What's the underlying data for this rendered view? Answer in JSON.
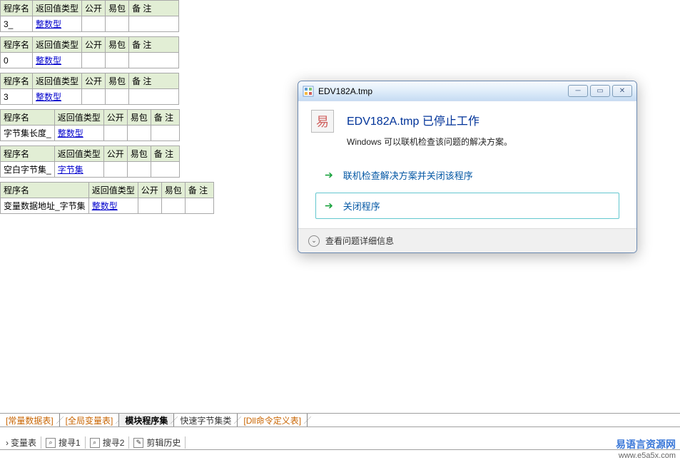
{
  "headers": {
    "proc_name": "程序名",
    "return_type": "返回值类型",
    "public": "公开",
    "epkg": "易包",
    "remark": "备 注"
  },
  "types": {
    "integer": "整数型",
    "byteset": "字节集"
  },
  "rows": [
    {
      "name_suffix": "3_",
      "ret_key": "integer"
    },
    {
      "name_suffix": "0",
      "ret_key": "integer"
    },
    {
      "name_suffix": "3",
      "ret_key": "integer"
    }
  ],
  "wide_rows": [
    {
      "name": "字节集长度_",
      "ret_key": "integer"
    },
    {
      "name": "空白字节集_",
      "ret_key": "byteset"
    }
  ],
  "widest_row": {
    "name": "变量数据地址_字节集",
    "ret_key": "integer"
  },
  "dialog": {
    "title": "EDV182A.tmp",
    "heading_prefix": "EDV182A.tmp",
    "heading_suffix": " 已停止工作",
    "subtext": "Windows 可以联机检查该问题的解决方案。",
    "option1": "联机检查解决方案并关闭该程序",
    "option2": "关闭程序",
    "details": "查看问题详细信息"
  },
  "tabs": [
    {
      "label": "[常量数据表]",
      "style": "orange"
    },
    {
      "label": "[全局变量表]",
      "style": "orange"
    },
    {
      "label": "模块程序集",
      "style": "active"
    },
    {
      "label": "快速字节集类",
      "style": "normal"
    },
    {
      "label": "[Dll命令定义表]",
      "style": "orange"
    }
  ],
  "toolbar": [
    {
      "label": "变量表",
      "icon": "≡"
    },
    {
      "label": "搜寻1",
      "icon": "⌕"
    },
    {
      "label": "搜寻2",
      "icon": "⌕"
    },
    {
      "label": "剪辑历史",
      "icon": "✎"
    }
  ],
  "watermark": {
    "cn": "易语言资源网",
    "url": "www.e5a5x.com"
  }
}
